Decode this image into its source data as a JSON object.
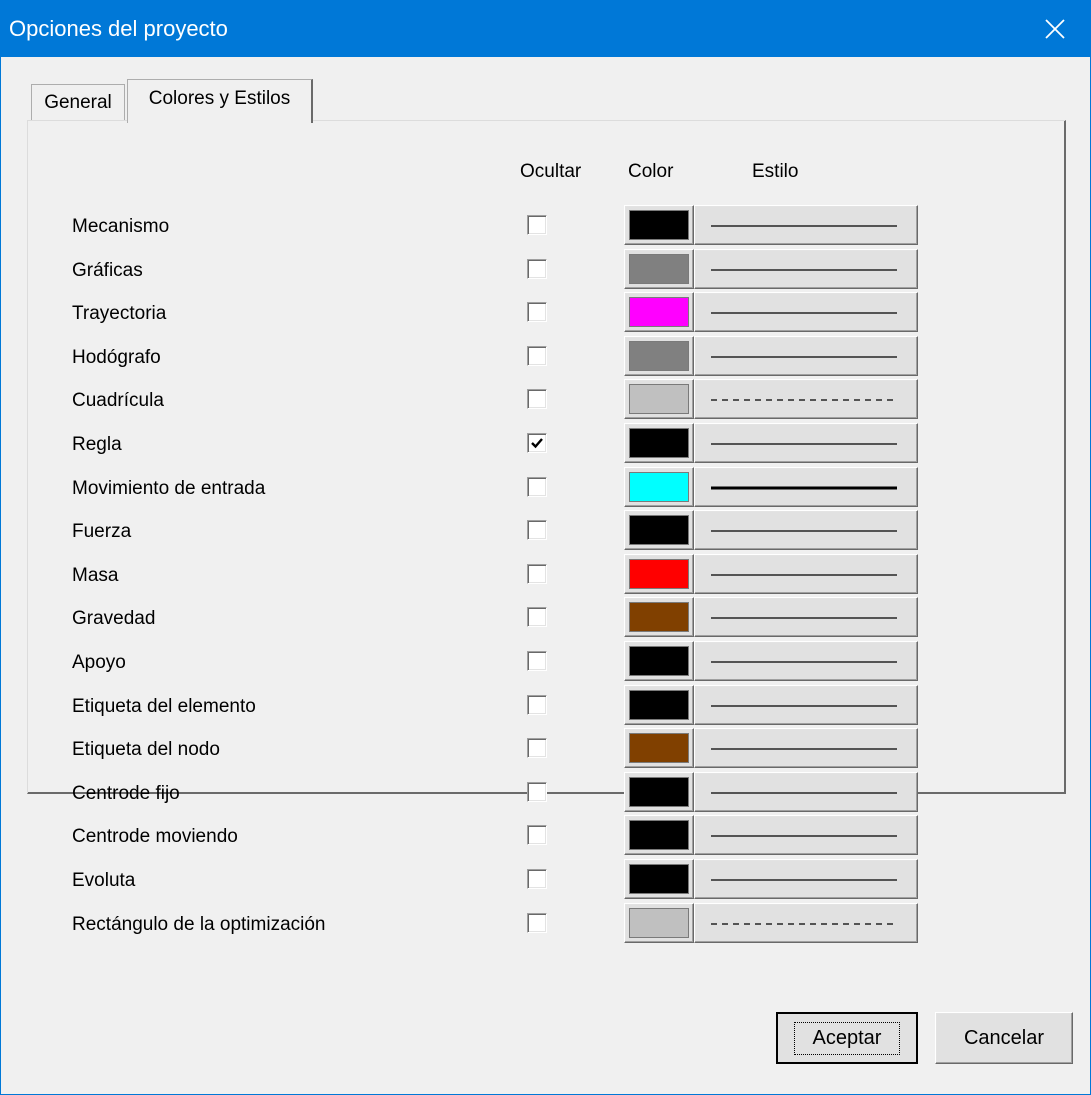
{
  "window": {
    "title": "Opciones del proyecto"
  },
  "tabs": [
    {
      "label": "General",
      "active": false
    },
    {
      "label": "Colores y Estilos",
      "active": true
    }
  ],
  "columns": {
    "hide": "Ocultar",
    "color": "Color",
    "style": "Estilo"
  },
  "rows": [
    {
      "label": "Mecanismo",
      "hidden": false,
      "color": "#000000",
      "style": "solid"
    },
    {
      "label": "Gráficas",
      "hidden": false,
      "color": "#808080",
      "style": "solid"
    },
    {
      "label": "Trayectoria",
      "hidden": false,
      "color": "#ff00ff",
      "style": "solid"
    },
    {
      "label": "Hodógrafo",
      "hidden": false,
      "color": "#808080",
      "style": "solid"
    },
    {
      "label": "Cuadrícula",
      "hidden": false,
      "color": "#c0c0c0",
      "style": "dashed"
    },
    {
      "label": "Regla",
      "hidden": true,
      "color": "#000000",
      "style": "solid"
    },
    {
      "label": "Movimiento de entrada",
      "hidden": false,
      "color": "#00ffff",
      "style": "solid-thick"
    },
    {
      "label": "Fuerza",
      "hidden": false,
      "color": "#000000",
      "style": "solid"
    },
    {
      "label": "Masa",
      "hidden": false,
      "color": "#ff0000",
      "style": "solid"
    },
    {
      "label": "Gravedad",
      "hidden": false,
      "color": "#804000",
      "style": "solid"
    },
    {
      "label": "Apoyo",
      "hidden": false,
      "color": "#000000",
      "style": "solid"
    },
    {
      "label": "Etiqueta del elemento",
      "hidden": false,
      "color": "#000000",
      "style": "solid"
    },
    {
      "label": "Etiqueta del nodo",
      "hidden": false,
      "color": "#804000",
      "style": "solid"
    },
    {
      "label": "Centrode fijo",
      "hidden": false,
      "color": "#000000",
      "style": "solid"
    },
    {
      "label": "Centrode moviendo",
      "hidden": false,
      "color": "#000000",
      "style": "solid"
    },
    {
      "label": "Evoluta",
      "hidden": false,
      "color": "#000000",
      "style": "solid"
    },
    {
      "label": "Rectángulo de la optimización",
      "hidden": false,
      "color": "#c0c0c0",
      "style": "dashed"
    }
  ],
  "buttons": {
    "ok": "Aceptar",
    "cancel": "Cancelar"
  },
  "accent": "#0078d7"
}
